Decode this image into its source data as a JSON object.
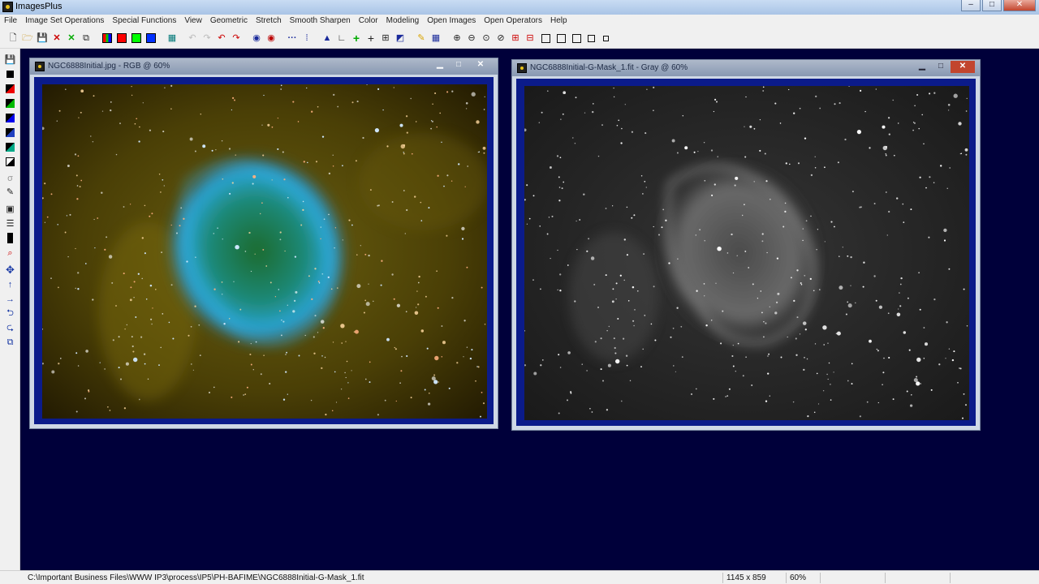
{
  "app": {
    "title": "ImagesPlus"
  },
  "menu": [
    "File",
    "Image Set Operations",
    "Special Functions",
    "View",
    "Geometric",
    "Stretch",
    "Smooth Sharpen",
    "Color",
    "Modeling",
    "Open Images",
    "Open Operators",
    "Help"
  ],
  "toolbar_icons": [
    "new-icon",
    "open-icon",
    "save-icon",
    "close-image-icon",
    "close-all-icon",
    "copy-icon",
    "rgb-channels-icon",
    "red-channel-icon",
    "green-channel-icon",
    "blue-channel-icon",
    "grid-icon",
    "undo-icon",
    "redo-icon",
    "undo-all-icon",
    "redo-all-icon",
    "circle-select-icon",
    "circle-fill-icon",
    "dotted-line-icon",
    "points-icon",
    "triangle-icon",
    "angle-icon",
    "crosshair-green-icon",
    "crosshair-icon",
    "table-icon",
    "paint-icon",
    "pencil-icon",
    "grid-view-icon",
    "zoom-in-icon",
    "zoom-out-icon",
    "zoom-fit-icon",
    "zoom-reset-icon",
    "add-icon",
    "subtract-icon",
    "frame-a-icon",
    "frame-b-icon",
    "frame-c-icon",
    "frame-d-icon",
    "frame-e-icon"
  ],
  "windows": [
    {
      "title": "NGC6888Initial.jpg - RGB @ 60%",
      "type": "color"
    },
    {
      "title": "NGC6888Initial-G-Mask_1.fit - Gray @ 60%",
      "type": "gray"
    }
  ],
  "status": {
    "path": "C:\\Important Business Files\\WWW IP3\\process\\IP5\\PH-BAFIME\\NGC6888Initial-G-Mask_1.fit",
    "dimensions": "1145 x 859",
    "zoom": "60%"
  },
  "colors": {
    "workspace": "#00003a",
    "frame": "#0b1b8a"
  }
}
